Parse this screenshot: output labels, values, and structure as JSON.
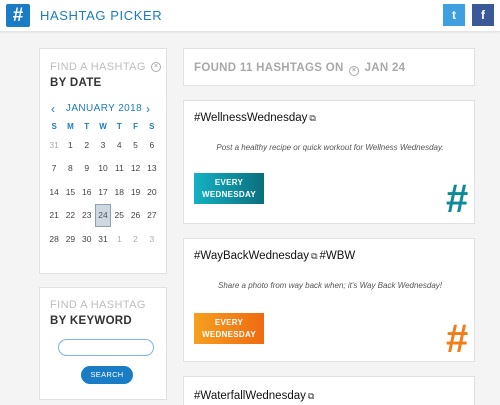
{
  "app": {
    "logo_symbol": "#",
    "title": "HASHTAG PICKER",
    "social": {
      "twitter": "t",
      "facebook": "f"
    }
  },
  "date_panel": {
    "subtitle": "FIND A HASHTAG",
    "title": "BY DATE",
    "clear": "×",
    "calendar": {
      "month_label": "JANUARY 2018",
      "prev": "‹",
      "next": "›",
      "weekdays": [
        "S",
        "M",
        "T",
        "W",
        "T",
        "F",
        "S"
      ],
      "weeks": [
        [
          "31",
          "1",
          "2",
          "3",
          "4",
          "5",
          "6"
        ],
        [
          "7",
          "8",
          "9",
          "10",
          "11",
          "12",
          "13"
        ],
        [
          "14",
          "15",
          "16",
          "17",
          "18",
          "19",
          "20"
        ],
        [
          "21",
          "22",
          "23",
          "24",
          "25",
          "26",
          "27"
        ],
        [
          "28",
          "29",
          "30",
          "31",
          "1",
          "2",
          "3"
        ]
      ],
      "selected": "24"
    }
  },
  "keyword_panel": {
    "subtitle": "FIND A HASHTAG",
    "title": "BY KEYWORD",
    "search_value": "",
    "clear": "×",
    "button": "SEARCH"
  },
  "results": {
    "prefix": "FOUND 11 HASHTAGS ON",
    "clear": "×",
    "date": "JAN 24"
  },
  "cards": [
    {
      "tag": "#WellnessWednesday",
      "desc": "Post a healthy recipe or quick workout for Wellness Wednesday.",
      "badge_line1": "EVERY",
      "badge_line2": "WEDNESDAY",
      "color": "#0e8a96"
    },
    {
      "tag": "#WayBackWednesday",
      "tag2": "#WBW",
      "desc": "Share a photo from way back when; it's Way Back Wednesday!",
      "badge_line1": "EVERY",
      "badge_line2": "WEDNESDAY",
      "color": "#f07d1a"
    },
    {
      "tag": "#WaterfallWednesday"
    }
  ],
  "copy_icon": "⧉",
  "hash_symbol": "#"
}
